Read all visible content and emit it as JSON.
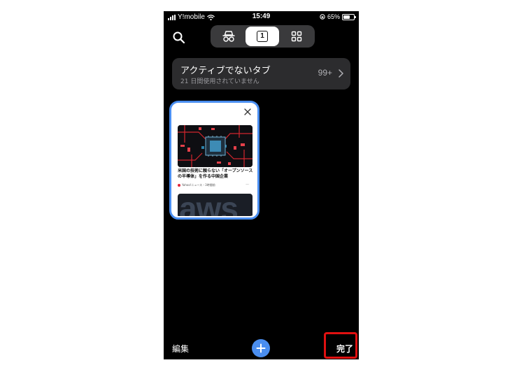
{
  "status_bar": {
    "carrier": "Y!mobile",
    "time": "15:49",
    "battery_percent": "65%",
    "battery_level": 0.65
  },
  "top_bar": {
    "search_icon": "search-icon",
    "segments": [
      {
        "name": "incognito",
        "icon": "incognito-icon",
        "selected": false
      },
      {
        "name": "tabs",
        "label": "1",
        "selected": true
      },
      {
        "name": "tab-groups",
        "icon": "grid-icon",
        "selected": false
      }
    ]
  },
  "inactive_tabs": {
    "title": "アクティブでないタブ",
    "subtitle": "21 日間使用されていません",
    "count": "99+"
  },
  "tab_card": {
    "headline": "米国の技術に頼らない「オープンソースの半導体」を作る中国企業",
    "source": "Yahoo!ニュース・3時間前",
    "more": "···",
    "aws_text": "aws"
  },
  "toolbar": {
    "edit_label": "編集",
    "done_label": "完了"
  },
  "colors": {
    "accent": "#4a8ef0",
    "highlight": "#e01010",
    "background": "#000000",
    "card": "#2c2c2e"
  }
}
